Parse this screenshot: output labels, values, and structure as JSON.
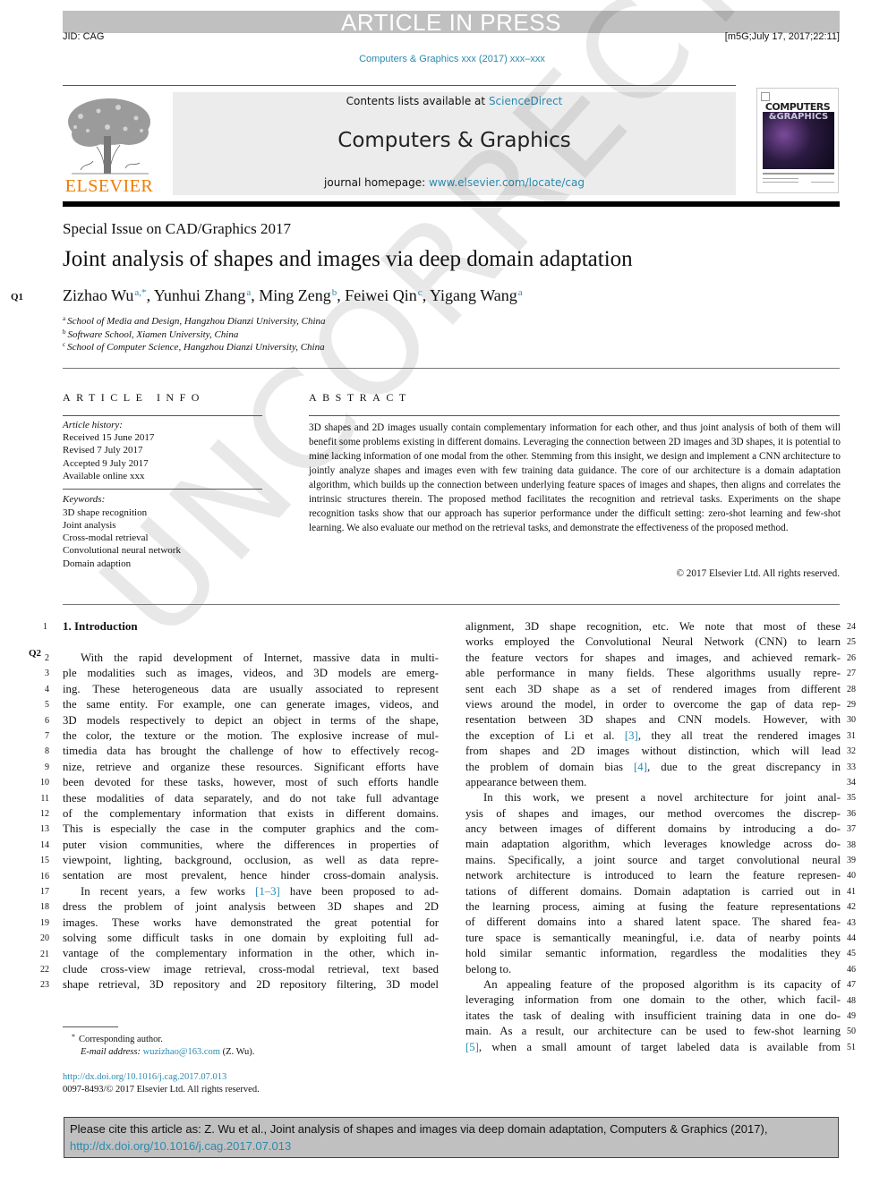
{
  "banner": "ARTICLE IN PRESS",
  "jid": "JID: CAG",
  "stamp": "[m5G;July 17, 2017;22:11]",
  "journal_ref": "Computers & Graphics xxx (2017) xxx–xxx",
  "masthead": {
    "publisher_logo_text": "ELSEVIER",
    "contents_prefix": "Contents lists available at ",
    "contents_link": "ScienceDirect",
    "journal_name": "Computers & Graphics",
    "homepage_prefix": "journal homepage: ",
    "homepage_link": "www.elsevier.com/locate/cag",
    "cover_title_1": "COMPUTERS",
    "cover_title_2": "&GRAPHICS"
  },
  "watermark": "UNCORRECTED PROOF",
  "special_issue": "Special Issue on CAD/Graphics 2017",
  "title": "Joint analysis of shapes and images via deep domain adaptation",
  "query_marks": {
    "q1": "Q1",
    "q2": "Q2"
  },
  "authors": [
    {
      "name": "Zizhao Wu",
      "sup": "a,*",
      "sep": ", "
    },
    {
      "name": "Yunhui Zhang",
      "sup": "a",
      "sep": ", "
    },
    {
      "name": "Ming Zeng",
      "sup": "b",
      "sep": ", "
    },
    {
      "name": "Feiwei Qin",
      "sup": "c",
      "sep": ", "
    },
    {
      "name": "Yigang Wang",
      "sup": "a",
      "sep": ""
    }
  ],
  "affiliations": [
    {
      "key": "a",
      "text": "School of Media and Design, Hangzhou Dianzi University, China"
    },
    {
      "key": "b",
      "text": "Software School, Xiamen University, China"
    },
    {
      "key": "c",
      "text": "School of Computer Science, Hangzhou Dianzi University, China"
    }
  ],
  "article_info": {
    "heading": "ARTICLE INFO",
    "history_label": "Article history:",
    "history": [
      "Received 15 June 2017",
      "Revised 7 July 2017",
      "Accepted 9 July 2017",
      "Available online xxx"
    ],
    "keywords_label": "Keywords:",
    "keywords": [
      "3D shape recognition",
      "Joint analysis",
      "Cross-modal retrieval",
      "Convolutional neural network",
      "Domain adaption"
    ]
  },
  "abstract": {
    "heading": "ABSTRACT",
    "text": "3D shapes and 2D images usually contain complementary information for each other, and thus joint analysis of both of them will benefit some problems existing in different domains. Leveraging the connection between 2D images and 3D shapes, it is potential to mine lacking information of one modal from the other. Stemming from this insight, we design and implement a CNN architecture to jointly analyze shapes and images even with few training data guidance. The core of our architecture is a domain adaptation algorithm, which builds up the connection between underlying feature spaces of images and shapes, then aligns and correlates the intrinsic structures therein. The proposed method facilitates the recognition and retrieval tasks. Experiments on the shape recognition tasks show that our approach has superior performance under the difficult setting: zero-shot learning and few-shot learning. We also evaluate our method on the retrieval tasks, and demonstrate the effectiveness of the proposed method.",
    "copyright": "© 2017 Elsevier Ltd. All rights reserved."
  },
  "section_heading": "1. Introduction",
  "left_column": [
    {
      "n": "2",
      "t": "With the rapid development of Internet, massive data in multi-",
      "indent": true
    },
    {
      "n": "3",
      "t": "ple modalities such as images, videos, and 3D models are emerg-"
    },
    {
      "n": "4",
      "t": "ing. These heterogeneous data are usually associated to represent"
    },
    {
      "n": "5",
      "t": "the same entity. For example, one can generate images, videos, and"
    },
    {
      "n": "6",
      "t": "3D models respectively to depict an object in terms of the shape,"
    },
    {
      "n": "7",
      "t": "the color, the texture or the motion. The explosive increase of mul-"
    },
    {
      "n": "8",
      "t": "timedia data has brought the challenge of how to effectively recog-"
    },
    {
      "n": "9",
      "t": "nize, retrieve and organize these resources. Significant efforts have"
    },
    {
      "n": "10",
      "t": "been devoted for these tasks, however, most of such efforts handle"
    },
    {
      "n": "11",
      "t": "these modalities of data separately, and do not take full advantage"
    },
    {
      "n": "12",
      "t": "of the complementary information that exists in different domains."
    },
    {
      "n": "13",
      "t": "This is especially the case in the computer graphics and the com-"
    },
    {
      "n": "14",
      "t": "puter vision communities, where the differences in properties of"
    },
    {
      "n": "15",
      "t": "viewpoint, lighting, background, occlusion, as well as data repre-"
    },
    {
      "n": "16",
      "t": "sentation are most prevalent, hence hinder cross-domain analysis."
    },
    {
      "n": "17",
      "t": "In recent years, a few works ",
      "cite": "[1–3]",
      "after": " have been proposed to ad-",
      "indent": true
    },
    {
      "n": "18",
      "t": "dress the problem of joint analysis between 3D shapes and 2D"
    },
    {
      "n": "19",
      "t": "images. These works have demonstrated the great potential for"
    },
    {
      "n": "20",
      "t": "solving some difficult tasks in one domain by exploiting full ad-"
    },
    {
      "n": "21",
      "t": "vantage of the complementary information in the other, which in-"
    },
    {
      "n": "22",
      "t": "clude cross-view image retrieval, cross-modal retrieval, text based"
    },
    {
      "n": "23",
      "t": "shape retrieval, 3D repository and 2D repository filtering, 3D model"
    }
  ],
  "right_column": [
    {
      "n": "24",
      "t": "alignment, 3D shape recognition, etc. We note that most of these"
    },
    {
      "n": "25",
      "t": "works employed the Convolutional Neural Network (CNN) to learn"
    },
    {
      "n": "26",
      "t": "the feature vectors for shapes and images, and achieved remark-"
    },
    {
      "n": "27",
      "t": "able performance in many fields. These algorithms usually repre-"
    },
    {
      "n": "28",
      "t": "sent each 3D shape as a set of rendered images from different"
    },
    {
      "n": "29",
      "t": "views around the model, in order to overcome the gap of data rep-"
    },
    {
      "n": "30",
      "t": "resentation between 3D shapes and CNN models. However, with"
    },
    {
      "n": "31",
      "t": "the exception of Li et al. ",
      "cite": "[3]",
      "after": ", they all treat the rendered images"
    },
    {
      "n": "32",
      "t": "from shapes and 2D images without distinction, which will lead"
    },
    {
      "n": "33",
      "t": "the problem of domain bias ",
      "cite": "[4]",
      "after": ", due to the great discrepancy in"
    },
    {
      "n": "34",
      "t": "appearance between them.",
      "last": true
    },
    {
      "n": "35",
      "t": "In this work, we present a novel architecture for joint anal-",
      "indent": true
    },
    {
      "n": "36",
      "t": "ysis of shapes and images, our method overcomes the discrep-"
    },
    {
      "n": "37",
      "t": "ancy between images of different domains by introducing a do-"
    },
    {
      "n": "38",
      "t": "main adaptation algorithm, which leverages knowledge across do-"
    },
    {
      "n": "39",
      "t": "mains. Specifically, a joint source and target convolutional neural"
    },
    {
      "n": "40",
      "t": "network architecture is introduced to learn the feature represen-"
    },
    {
      "n": "41",
      "t": "tations of different domains. Domain adaptation is carried out in"
    },
    {
      "n": "42",
      "t": "the learning process, aiming at fusing the feature representations"
    },
    {
      "n": "43",
      "t": "of different domains into a shared latent space. The shared fea-"
    },
    {
      "n": "44",
      "t": "ture space is semantically meaningful, i.e. data of nearby points"
    },
    {
      "n": "45",
      "t": "hold similar semantic information, regardless the modalities they"
    },
    {
      "n": "46",
      "t": "belong to.",
      "last": true
    },
    {
      "n": "47",
      "t": "An appealing feature of the proposed algorithm is its capacity of",
      "indent": true
    },
    {
      "n": "48",
      "t": "leveraging information from one domain to the other, which facil-"
    },
    {
      "n": "49",
      "t": "itates the task of dealing with insufficient training data in one do-"
    },
    {
      "n": "50",
      "t": "main. As a result, our architecture can be used to few-shot learning"
    },
    {
      "n": "51",
      "t": "",
      "cite": "[5]",
      "after": ", when a small amount of target labeled data is available from"
    }
  ],
  "footnotes": {
    "corresponding_mark": "*",
    "corresponding": "Corresponding author.",
    "email_label": "E-mail address: ",
    "email": "wuzizhao@163.com",
    "email_suffix": " (Z. Wu).",
    "doi": "http://dx.doi.org/10.1016/j.cag.2017.07.013",
    "issn": "0097-8493/© 2017 Elsevier Ltd. All rights reserved."
  },
  "cite_box": {
    "text": "Please cite this article as: Z. Wu et al., Joint analysis of shapes and images via deep domain adaptation, Computers & Graphics (2017),",
    "link": "http://dx.doi.org/10.1016/j.cag.2017.07.013"
  },
  "colors": {
    "link": "#2a8ab0",
    "elsevier_orange": "#f07c00",
    "banner_gray": "#c0c0c0",
    "masthead_bg": "#ececec"
  }
}
